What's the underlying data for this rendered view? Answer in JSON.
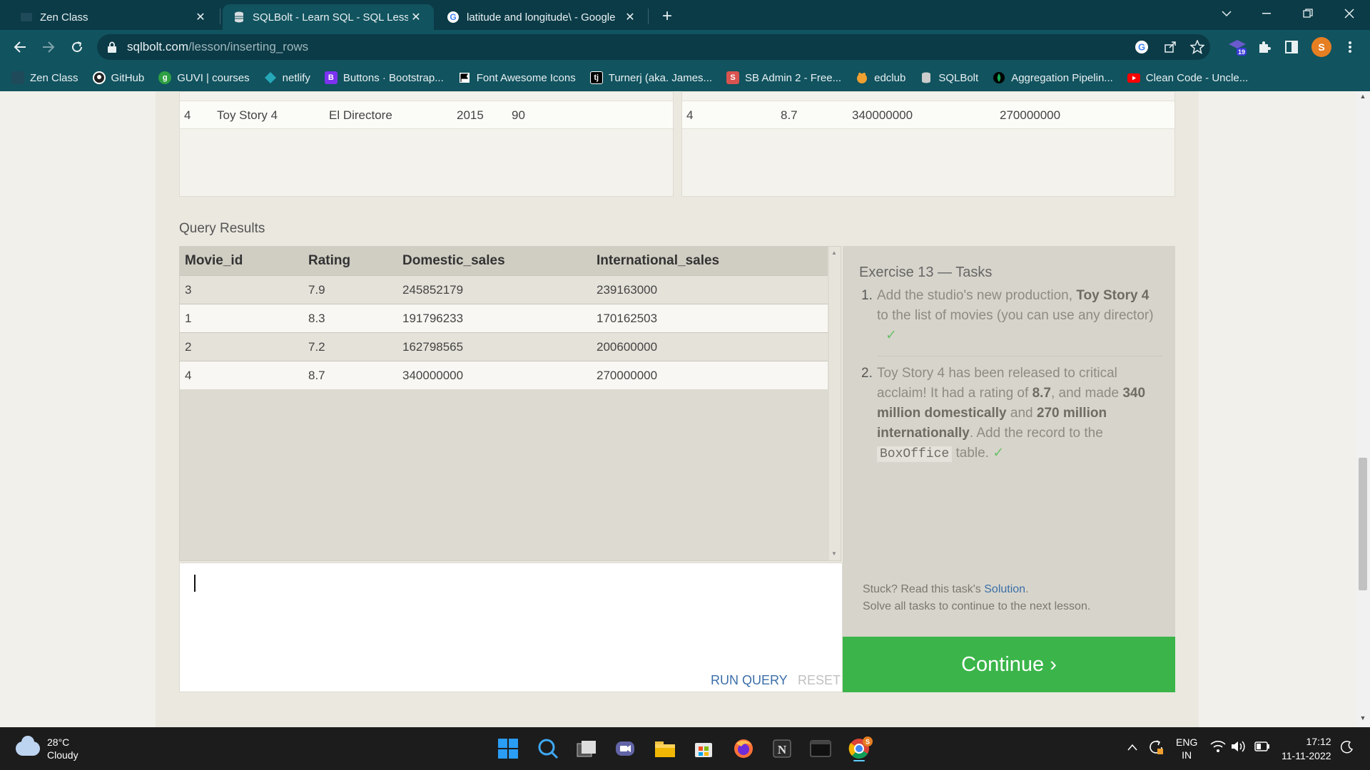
{
  "browser": {
    "tabs": [
      {
        "label": "Zen Class",
        "icon": "zen-icon"
      },
      {
        "label": "SQLBolt - Learn SQL - SQL Lesson",
        "icon": "database-icon"
      },
      {
        "label": "latitude and longitude\\ - Google",
        "icon": "google-icon"
      }
    ],
    "close_glyph": "✕",
    "new_tab": "+",
    "url_host": "sqlbolt.com",
    "url_path": "/lesson/inserting_rows",
    "extension_badge": "19",
    "profile_initial": "S",
    "bookmarks": [
      {
        "label": "Zen Class",
        "icon": "zen-icon",
        "color": "#1f4a5a"
      },
      {
        "label": "GitHub",
        "icon": "github-icon",
        "color": "#222222"
      },
      {
        "label": "GUVI | courses",
        "icon": "guvi-icon",
        "color": "#2ea043"
      },
      {
        "label": "netlify",
        "icon": "netlify-icon",
        "color": "#26a8b8"
      },
      {
        "label": "Buttons · Bootstrap...",
        "icon": "bootstrap-icon",
        "color": "#7b33f0"
      },
      {
        "label": "Font Awesome Icons",
        "icon": "flag-icon",
        "color": "#ffffff"
      },
      {
        "label": "Turnerj (aka. James...",
        "icon": "tj-icon",
        "color": "#000000"
      },
      {
        "label": "SB Admin 2 - Free...",
        "icon": "sb-admin-icon",
        "color": "#d9534f"
      },
      {
        "label": "edclub",
        "icon": "edclub-icon",
        "color": "#f0a030"
      },
      {
        "label": "SQLBolt",
        "icon": "database-icon",
        "color": "#cccccc"
      },
      {
        "label": "Aggregation Pipelin...",
        "icon": "mongodb-icon",
        "color": "#13aa52"
      },
      {
        "label": "Clean Code - Uncle...",
        "icon": "youtube-icon",
        "color": "#ff0000"
      }
    ]
  },
  "top_tables": {
    "movies_row": {
      "id": "4",
      "title": "Toy Story 4",
      "director": "El Directore",
      "year": "2015",
      "length": "90"
    },
    "boxoffice_row": {
      "id": "4",
      "rating": "8.7",
      "domestic": "340000000",
      "international": "270000000"
    }
  },
  "query_results": {
    "label": "Query Results",
    "columns": [
      "Movie_id",
      "Rating",
      "Domestic_sales",
      "International_sales"
    ],
    "rows": [
      [
        "3",
        "7.9",
        "245852179",
        "239163000"
      ],
      [
        "1",
        "8.3",
        "191796233",
        "170162503"
      ],
      [
        "2",
        "7.2",
        "162798565",
        "200600000"
      ],
      [
        "4",
        "8.7",
        "340000000",
        "270000000"
      ]
    ]
  },
  "editor": {
    "run_label": "RUN QUERY",
    "reset_label": "RESET"
  },
  "tasks": {
    "title": "Exercise 13 — Tasks",
    "items": [
      {
        "num": "1.",
        "parts": [
          "Add the studio's new production, ",
          "Toy Story 4",
          " to the list of movies (you can use any director)"
        ]
      },
      {
        "num": "2.",
        "parts": [
          "Toy Story 4 has been released to critical acclaim! It had a rating of ",
          "8.7",
          ", and made ",
          "340 million domestically",
          " and ",
          "270 million internationally",
          ". Add the record to the ",
          "BoxOffice",
          " table."
        ]
      }
    ],
    "check": "✓",
    "stuck_text": "Stuck? Read this task's ",
    "solution_link": "Solution",
    "stuck_suffix": ".",
    "solve_all": "Solve all tasks to continue to the next lesson.",
    "continue_label": "Continue ›"
  },
  "taskbar": {
    "temperature": "28°C",
    "weather": "Cloudy",
    "lang": "ENG",
    "region": "IN",
    "time": "17:12",
    "date": "11-11-2022",
    "chrome_badge": "S"
  },
  "colors": {
    "continue": "#3bb54a",
    "browser_frame": "#11535f",
    "tab_strip": "#0b3b47"
  }
}
